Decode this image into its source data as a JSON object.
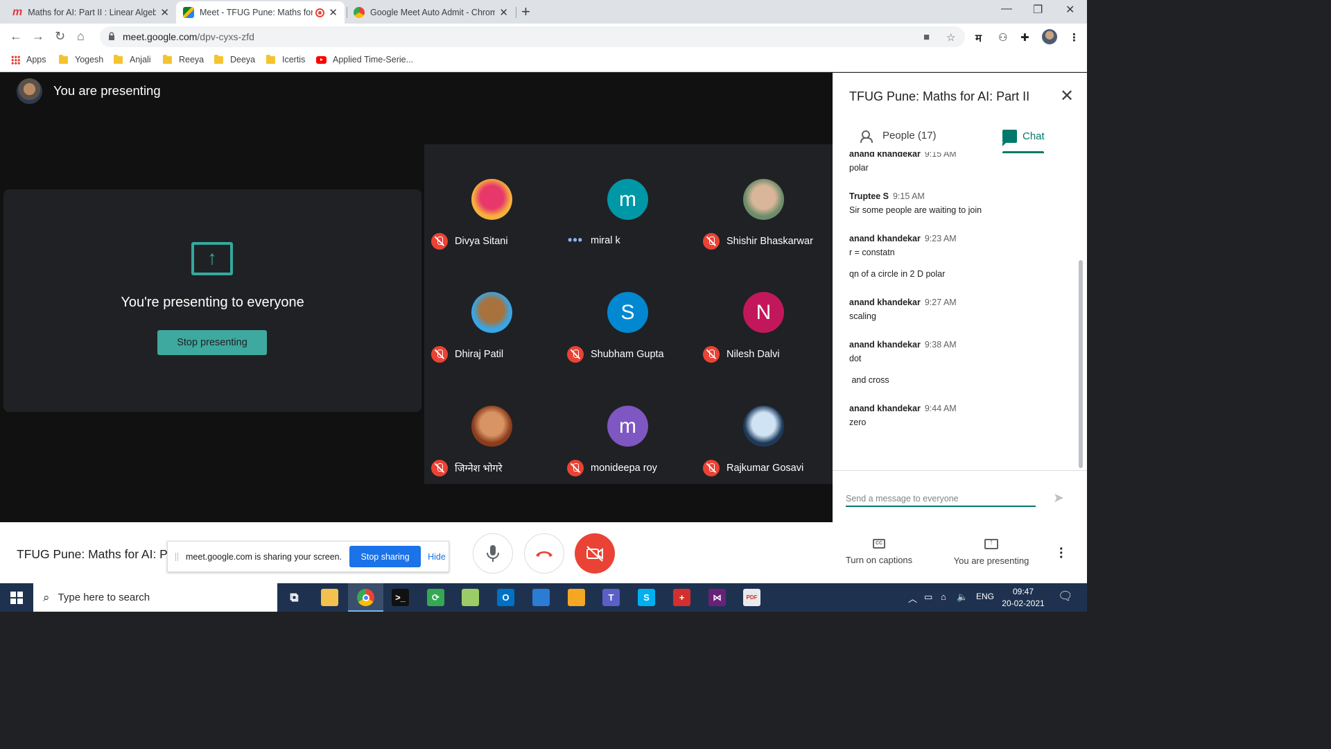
{
  "browser": {
    "tabs": [
      {
        "title": "Maths for AI: Part II : Linear Algebra",
        "icon": "meetup-m-icon",
        "active": false
      },
      {
        "title": "Meet - TFUG Pune: Maths for AI",
        "icon": "google-meet-icon",
        "active": true,
        "recording": true
      },
      {
        "title": "Google Meet Auto Admit - Chrome",
        "icon": "chrome-webstore-icon",
        "active": false
      }
    ],
    "url_host": "meet.google.com",
    "url_path": "/dpv-cyxs-zfd",
    "bookmarks": [
      {
        "label": "Apps",
        "icon": "apps-grid-icon"
      },
      {
        "label": "Yogesh",
        "icon": "folder-icon"
      },
      {
        "label": "Anjali",
        "icon": "folder-icon"
      },
      {
        "label": "Reeya",
        "icon": "folder-icon"
      },
      {
        "label": "Deeya",
        "icon": "folder-icon"
      },
      {
        "label": "Icertis",
        "icon": "folder-icon"
      },
      {
        "label": "Applied Time-Serie...",
        "icon": "youtube-icon"
      }
    ]
  },
  "stage": {
    "presenting_title": "You are presenting",
    "present_message": "You're presenting to everyone",
    "stop_presenting_label": "Stop presenting"
  },
  "participants": [
    {
      "name": "Divya Sitani",
      "avatar_type": "photo",
      "avatar_colors": [
        "#e8386b",
        "#f6b13c"
      ],
      "muted": true
    },
    {
      "name": "miral k",
      "avatar_type": "letter",
      "letter": "m",
      "avatar_color": "#0097a7",
      "muted": false,
      "speaking": true
    },
    {
      "name": "Shishir Bhaskarwar",
      "avatar_type": "photo",
      "avatar_colors": [
        "#d9b69a",
        "#6d8c6a"
      ],
      "muted": true
    },
    {
      "name": "Dhiraj Patil",
      "avatar_type": "photo",
      "avatar_colors": [
        "#a7723d",
        "#36a7e8"
      ],
      "muted": true
    },
    {
      "name": "Shubham Gupta",
      "avatar_type": "letter",
      "letter": "S",
      "avatar_color": "#0288d1",
      "muted": true
    },
    {
      "name": "Nilesh Dalvi",
      "avatar_type": "letter",
      "letter": "N",
      "avatar_color": "#c2185b",
      "muted": true
    },
    {
      "name": "जिग्नेश भोगरे",
      "avatar_type": "photo",
      "avatar_colors": [
        "#d89464",
        "#8b3d1c"
      ],
      "muted": true
    },
    {
      "name": "monideepa roy",
      "avatar_type": "letter",
      "letter": "m",
      "avatar_color": "#7e57c2",
      "muted": true
    },
    {
      "name": "Rajkumar Gosavi",
      "avatar_type": "photo",
      "avatar_colors": [
        "#cfe3f5",
        "#1e3a5a"
      ],
      "muted": true
    }
  ],
  "bottom_bar": {
    "meeting_name": "TFUG Pune: Maths for AI: Part II",
    "share_banner_text": "meet.google.com is sharing your screen.",
    "stop_sharing_label": "Stop sharing",
    "hide_label": "Hide",
    "captions_label": "Turn on captions",
    "captions_icon_text": "CC",
    "presenting_label": "You are presenting"
  },
  "side_panel": {
    "title": "TFUG Pune: Maths for AI: Part II",
    "people_tab": "People (17)",
    "chat_tab": "Chat",
    "messages": [
      {
        "sender": "anand khandekar",
        "time": "9:15 AM",
        "lines": [
          "polar"
        ]
      },
      {
        "sender": "Truptee S",
        "time": "9:15 AM",
        "lines": [
          "Sir some people are waiting to join"
        ]
      },
      {
        "sender": "anand khandekar",
        "time": "9:23 AM",
        "lines": [
          "r = constatn",
          "qn of a circle in 2 D polar"
        ]
      },
      {
        "sender": "anand khandekar",
        "time": "9:27 AM",
        "lines": [
          "scaling"
        ]
      },
      {
        "sender": "anand khandekar",
        "time": "9:38 AM",
        "lines": [
          "dot",
          " and cross"
        ]
      },
      {
        "sender": "anand khandekar",
        "time": "9:44 AM",
        "lines": [
          "zero"
        ]
      }
    ],
    "composer_placeholder": "Send a message to everyone"
  },
  "taskbar": {
    "search_placeholder": "Type here to search",
    "language": "ENG",
    "time": "09:47",
    "date": "20-02-2021",
    "apps": [
      {
        "name": "task-view-icon",
        "color": "#1e3250",
        "glyph": "⧉"
      },
      {
        "name": "file-explorer-icon",
        "color": "#f2c14e",
        "glyph": ""
      },
      {
        "name": "chrome-icon",
        "color": "#ea4335",
        "glyph": ""
      },
      {
        "name": "terminal-icon",
        "color": "#111111",
        "glyph": ">_"
      },
      {
        "name": "sync-icon",
        "color": "#34a853",
        "glyph": "⟳"
      },
      {
        "name": "image-editor-icon",
        "color": "#9ccc65",
        "glyph": ""
      },
      {
        "name": "outlook-icon",
        "color": "#0072c6",
        "glyph": "O"
      },
      {
        "name": "remote-desktop-icon",
        "color": "#2b7cd3",
        "glyph": ""
      },
      {
        "name": "file-transfer-icon",
        "color": "#f5a623",
        "glyph": ""
      },
      {
        "name": "teams-icon",
        "color": "#5b5fc7",
        "glyph": "T"
      },
      {
        "name": "skype-icon",
        "color": "#00aff0",
        "glyph": "S"
      },
      {
        "name": "screen-recorder-icon",
        "color": "#d32f2f",
        "glyph": "+"
      },
      {
        "name": "visual-studio-icon",
        "color": "#68217a",
        "glyph": "⋈"
      },
      {
        "name": "pdf-viewer-icon",
        "color": "#e8eaed",
        "glyph": "PDF"
      }
    ]
  },
  "colors": {
    "meet_teal": "#00796b",
    "present_green": "#3ea99f",
    "hangup_red": "#ea4335",
    "share_blue": "#1a73e8"
  }
}
